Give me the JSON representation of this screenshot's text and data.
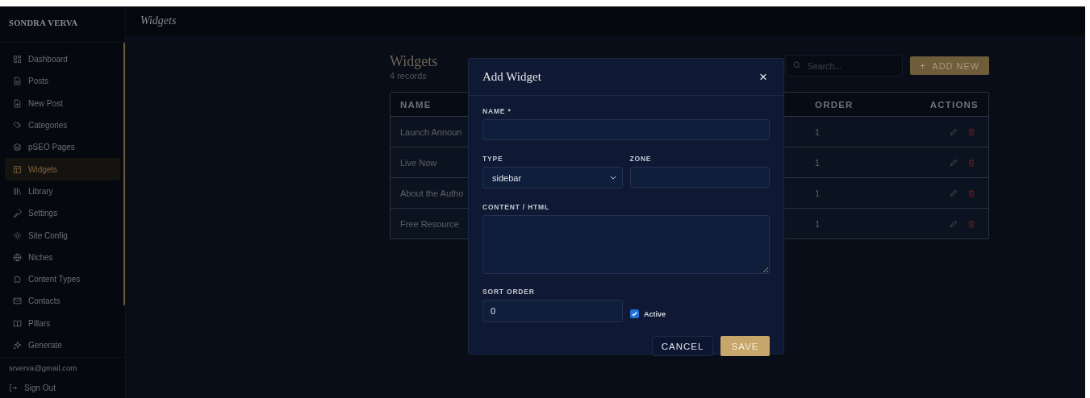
{
  "sidebar": {
    "brand": "SONDRA VERVA",
    "items": [
      {
        "label": "Dashboard",
        "selected": false
      },
      {
        "label": "Posts",
        "selected": false
      },
      {
        "label": "New Post",
        "selected": false
      },
      {
        "label": "Categories",
        "selected": false
      },
      {
        "label": "pSEO Pages",
        "selected": false
      },
      {
        "label": "Widgets",
        "selected": true
      },
      {
        "label": "Library",
        "selected": false
      },
      {
        "label": "Settings",
        "selected": false
      },
      {
        "label": "Site Config",
        "selected": false
      },
      {
        "label": "Niches",
        "selected": false
      },
      {
        "label": "Content Types",
        "selected": false
      },
      {
        "label": "Contacts",
        "selected": false
      },
      {
        "label": "Pillars",
        "selected": false
      },
      {
        "label": "Generate",
        "selected": false
      }
    ],
    "user_email": "srverva@gmail.com",
    "sign_out": "Sign Out"
  },
  "header": {
    "title": "Widgets"
  },
  "page": {
    "title": "Widgets",
    "count": "4 records",
    "search": {
      "placeholder": "Search..."
    },
    "add_button": {
      "icon": "+",
      "label": "ADD NEW"
    }
  },
  "table": {
    "columns": [
      "NAME",
      "ORDER",
      "ACTIONS"
    ],
    "rows": [
      {
        "name": "Launch Announ",
        "order": "1"
      },
      {
        "name": "Live Now",
        "order": "1"
      },
      {
        "name": "About the Autho",
        "order": "1"
      },
      {
        "name": "Free Resource",
        "order": "1"
      }
    ]
  },
  "modal": {
    "title": "Add Widget",
    "close": "×",
    "name_label": "NAME *",
    "type_label": "TYPE",
    "type_value": "sidebar",
    "zone_label": "ZONE",
    "content_label": "CONTENT / HTML",
    "sort_label": "SORT ORDER",
    "sort_value": "0",
    "active": {
      "label": "Active",
      "checked": true
    },
    "cancel": "CANCEL",
    "save": "SAVE"
  }
}
